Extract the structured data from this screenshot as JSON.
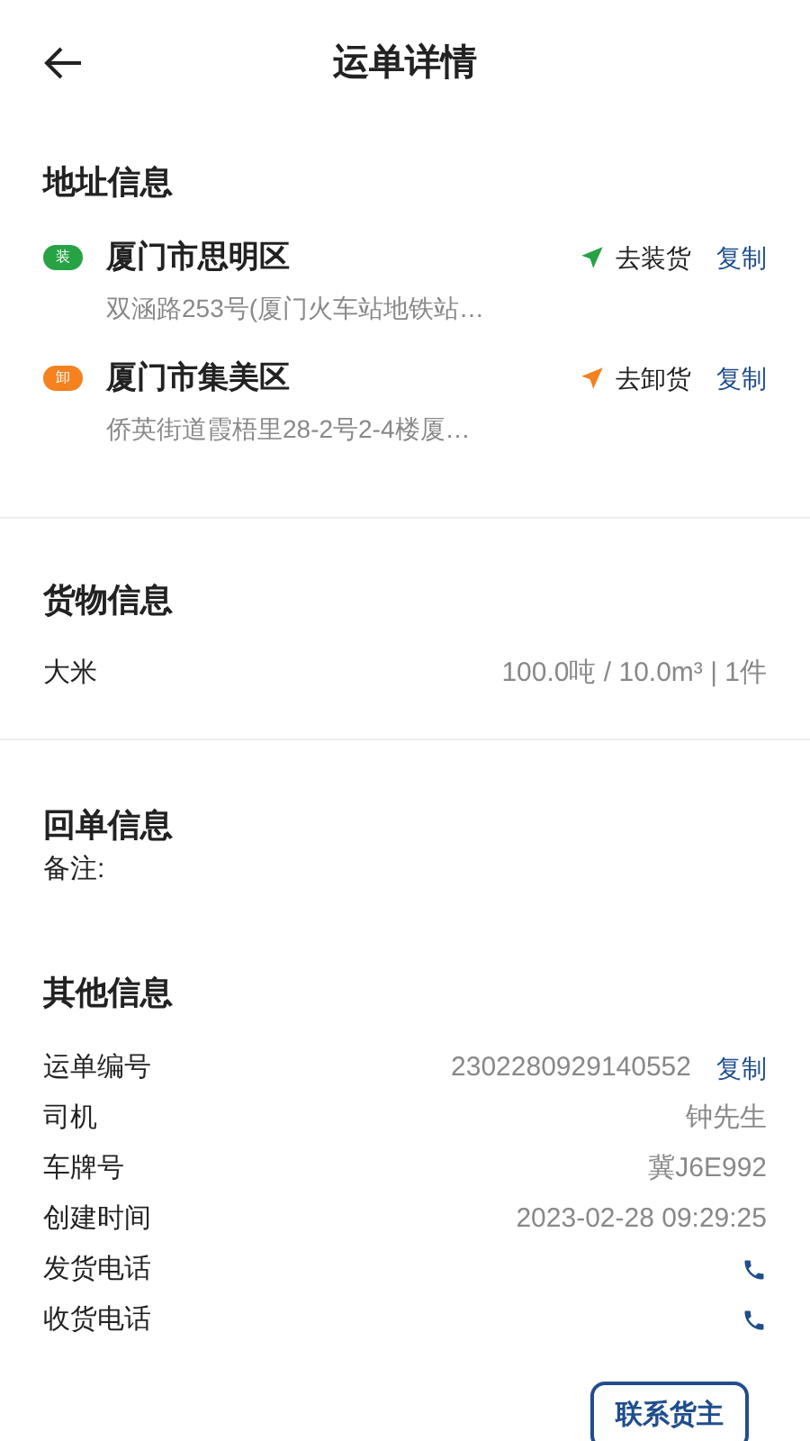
{
  "header": {
    "title": "运单详情"
  },
  "address": {
    "title": "地址信息",
    "stops": [
      {
        "badge": "装",
        "color": "#27a345",
        "city": "厦门市思明区",
        "action": "去装货",
        "copy": "复制",
        "detail": "双涵路253号(厦门火车站地铁站…"
      },
      {
        "badge": "卸",
        "color": "#f5811f",
        "city": "厦门市集美区",
        "action": "去卸货",
        "copy": "复制",
        "detail": "侨英街道霞梧里28-2号2-4楼厦…"
      }
    ]
  },
  "goods": {
    "title": "货物信息",
    "name": "大米",
    "spec": "100.0吨 / 10.0m³ | 1件"
  },
  "receipt": {
    "title": "回单信息",
    "note_label": "备注:"
  },
  "other": {
    "title": "其他信息",
    "rows": [
      {
        "kind": "copy",
        "label": "运单编号",
        "value": "2302280929140552",
        "action": "复制"
      },
      {
        "kind": "text",
        "label": "司机",
        "value": "钟先生"
      },
      {
        "kind": "text",
        "label": "车牌号",
        "value": "冀J6E992"
      },
      {
        "kind": "text",
        "label": "创建时间",
        "value": "2023-02-28 09:29:25"
      },
      {
        "kind": "phone",
        "label": "发货电话"
      },
      {
        "kind": "phone",
        "label": "收货电话"
      }
    ]
  },
  "contact_button": "联系货主"
}
